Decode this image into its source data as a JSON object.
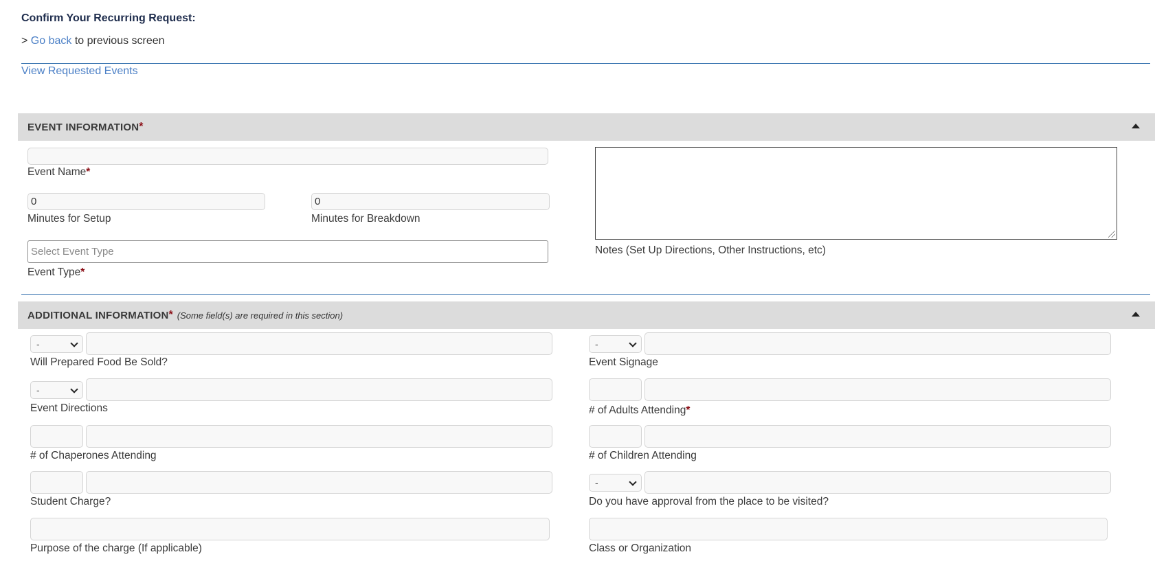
{
  "page": {
    "title": "Confirm Your Recurring Request:",
    "back_prefix": "> ",
    "back_link": "Go back",
    "back_suffix": " to previous screen",
    "view_link": "View Requested Events"
  },
  "event_info": {
    "header": "EVENT INFORMATION",
    "required_mark": "*",
    "event_name": {
      "label": "Event Name",
      "value": ""
    },
    "setup": {
      "label": "Minutes for Setup",
      "value": "0"
    },
    "breakdown": {
      "label": "Minutes for Breakdown",
      "value": "0"
    },
    "event_type": {
      "label": "Event Type",
      "placeholder": "Select Event Type"
    },
    "notes": {
      "label": "Notes (Set Up Directions, Other Instructions, etc)"
    }
  },
  "additional_info": {
    "header": "ADDITIONAL INFORMATION",
    "required_mark": "*",
    "note": "(Some field(s) are required in this section)",
    "food": {
      "label": "Will Prepared Food Be Sold?",
      "select": "-"
    },
    "signage": {
      "label": "Event Signage",
      "select": "-"
    },
    "directions": {
      "label": "Event Directions",
      "select": "-"
    },
    "adults": {
      "label": "# of Adults Attending"
    },
    "chaperones": {
      "label": "# of Chaperones Attending"
    },
    "children": {
      "label": "# of Children Attending"
    },
    "student_charge": {
      "label": "Student Charge?"
    },
    "approval": {
      "label": "Do you have approval from the place to be visited?",
      "select": "-"
    },
    "purpose": {
      "label": "Purpose of the charge (If applicable)"
    },
    "class_org": {
      "label": "Class or Organization"
    }
  }
}
